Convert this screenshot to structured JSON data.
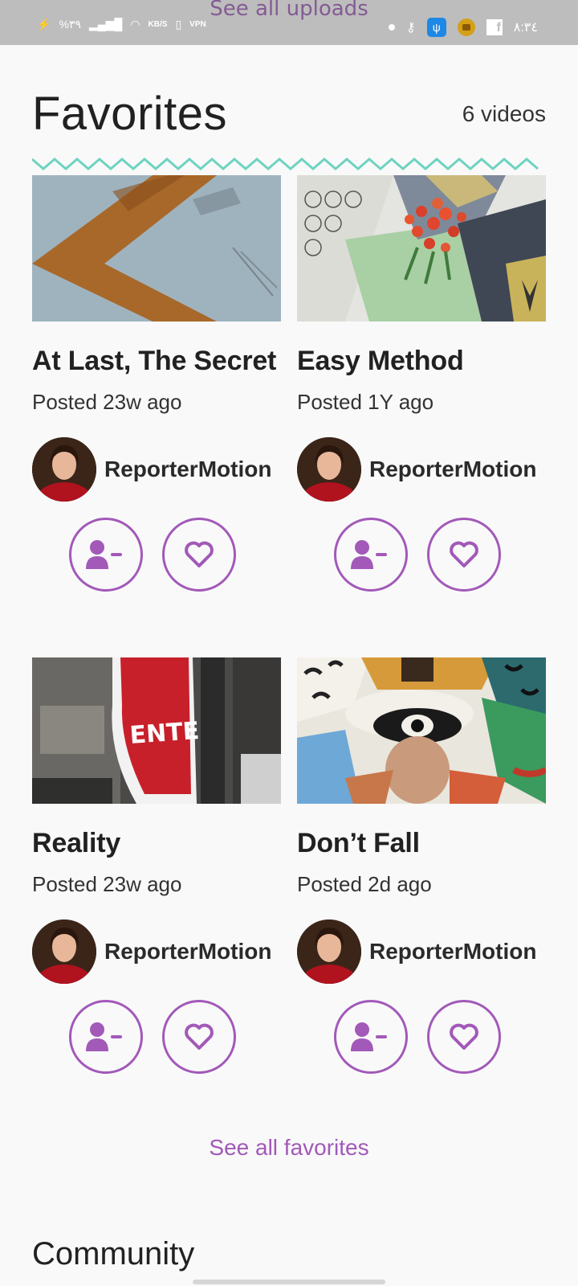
{
  "status_bar": {
    "ghost_text": "See all uploads",
    "battery": "%٣٩",
    "speed_unit": "KB/S",
    "vpn_label": "VPN",
    "time": "٨:٣٤"
  },
  "favorites": {
    "title": "Favorites",
    "count_label": "6 videos",
    "accent_color": "#a259b8",
    "zigzag_color": "#6fd3c0",
    "cards": [
      {
        "title": "At Last, The Secret",
        "posted": "Posted 23w ago",
        "author": "ReporterMotion",
        "thumbnail": "rusty-arrow-sign"
      },
      {
        "title": "Easy Method",
        "posted": "Posted 1Y ago",
        "author": "ReporterMotion",
        "thumbnail": "tulips-on-tiles"
      },
      {
        "title": "Reality",
        "posted": "Posted 23w ago",
        "author": "ReporterMotion",
        "thumbnail": "enter-sign"
      },
      {
        "title": "Don’t Fall",
        "posted": "Posted 2d ago",
        "author": "ReporterMotion",
        "thumbnail": "eye-mural"
      }
    ],
    "see_all_label": "See all favorites"
  },
  "community": {
    "title": "Community"
  }
}
